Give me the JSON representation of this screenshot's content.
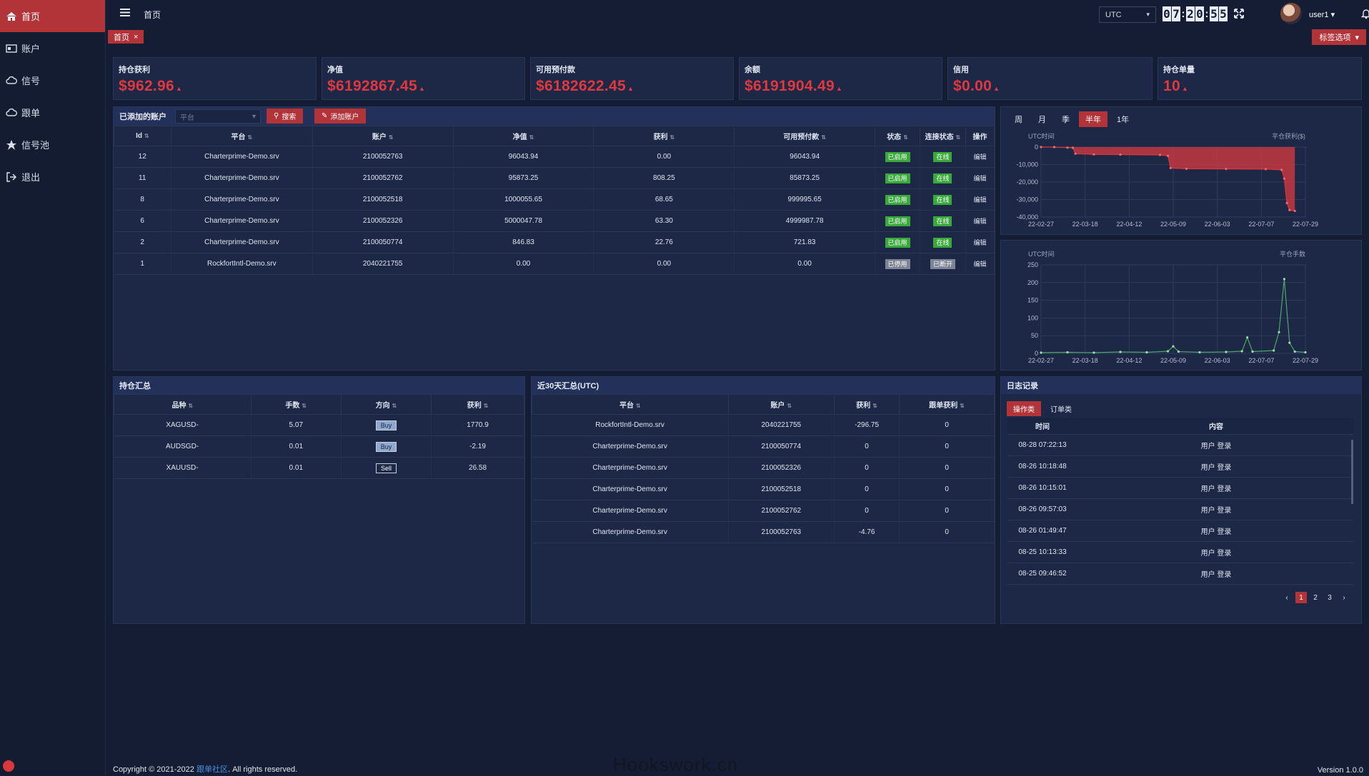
{
  "sidebar": {
    "items": [
      {
        "label": "首页",
        "icon": "home-icon"
      },
      {
        "label": "账户",
        "icon": "id-card-icon"
      },
      {
        "label": "信号",
        "icon": "cloud-icon"
      },
      {
        "label": "跟单",
        "icon": "cloud-icon"
      },
      {
        "label": "信号池",
        "icon": "star-icon"
      },
      {
        "label": "退出",
        "icon": "logout-icon"
      }
    ]
  },
  "header": {
    "breadcrumb": "首页",
    "timezone": "UTC",
    "clock": [
      "0",
      "7",
      ":",
      "2",
      "0",
      ":",
      "5",
      "5"
    ],
    "username": "user1",
    "tab": "首页",
    "tab_close": "×",
    "tab_options": "标签选项"
  },
  "stats": [
    {
      "label": "持仓获利",
      "value": "$962.96"
    },
    {
      "label": "净值",
      "value": "$6192867.45"
    },
    {
      "label": "可用预付款",
      "value": "$6182622.45"
    },
    {
      "label": "余额",
      "value": "$6191904.49"
    },
    {
      "label": "信用",
      "value": "$0.00"
    },
    {
      "label": "持仓单量",
      "value": "10"
    }
  ],
  "accounts": {
    "title": "已添加的账户",
    "platform_placeholder": "平台",
    "search_btn": "搜索",
    "add_btn": "添加账户",
    "columns": [
      "Id",
      "平台",
      "账户",
      "净值",
      "获利",
      "可用预付款",
      "状态",
      "连接状态",
      "操作"
    ],
    "rows": [
      {
        "id": "12",
        "platform": "Charterprime-Demo.srv",
        "account": "2100052763",
        "equity": "96043.94",
        "profit": "0.00",
        "free": "96043.94",
        "status": "已启用",
        "conn": "在线",
        "op": "编辑",
        "on": true
      },
      {
        "id": "11",
        "platform": "Charterprime-Demo.srv",
        "account": "2100052762",
        "equity": "95873.25",
        "profit": "808.25",
        "free": "85873.25",
        "status": "已启用",
        "conn": "在线",
        "op": "编辑",
        "on": true
      },
      {
        "id": "8",
        "platform": "Charterprime-Demo.srv",
        "account": "2100052518",
        "equity": "1000055.65",
        "profit": "68.65",
        "free": "999995.65",
        "status": "已启用",
        "conn": "在线",
        "op": "编辑",
        "on": true
      },
      {
        "id": "6",
        "platform": "Charterprime-Demo.srv",
        "account": "2100052326",
        "equity": "5000047.78",
        "profit": "63.30",
        "free": "4999987.78",
        "status": "已启用",
        "conn": "在线",
        "op": "编辑",
        "on": true
      },
      {
        "id": "2",
        "platform": "Charterprime-Demo.srv",
        "account": "2100050774",
        "equity": "846.83",
        "profit": "22.76",
        "free": "721.83",
        "status": "已启用",
        "conn": "在线",
        "op": "编辑",
        "on": true
      },
      {
        "id": "1",
        "platform": "RockfortIntl-Demo.srv",
        "account": "2040221755",
        "equity": "0.00",
        "profit": "0.00",
        "free": "0.00",
        "status": "已停用",
        "conn": "已断开",
        "op": "编辑",
        "on": false
      }
    ]
  },
  "chart_tabs": [
    "周",
    "月",
    "季",
    "半年",
    "1年"
  ],
  "chart_data": [
    {
      "type": "area",
      "xlabel": "UTC时间",
      "ylabel": "平仓获利($)",
      "x": [
        "22-02-27",
        "22-03-18",
        "22-04-12",
        "22-05-09",
        "22-06-03",
        "22-07-07",
        "22-07-29"
      ],
      "ylim": [
        -40000,
        0
      ],
      "yticks": [
        "0",
        "-10,000",
        "-20,000",
        "-30,000",
        "-40,000"
      ],
      "points": [
        [
          0,
          0
        ],
        [
          0.05,
          0
        ],
        [
          0.1,
          -300
        ],
        [
          0.12,
          -400
        ],
        [
          0.13,
          -3800
        ],
        [
          0.2,
          -4200
        ],
        [
          0.3,
          -4300
        ],
        [
          0.45,
          -4500
        ],
        [
          0.48,
          -5000
        ],
        [
          0.49,
          -12000
        ],
        [
          0.55,
          -12400
        ],
        [
          0.7,
          -12500
        ],
        [
          0.85,
          -12600
        ],
        [
          0.91,
          -13000
        ],
        [
          0.92,
          -18000
        ],
        [
          0.93,
          -32000
        ],
        [
          0.94,
          -36000
        ],
        [
          0.96,
          -36500
        ]
      ],
      "color": "#d9383f"
    },
    {
      "type": "line",
      "xlabel": "UTC时间",
      "ylabel": "平仓手数",
      "x": [
        "22-02-27",
        "22-03-18",
        "22-04-12",
        "22-05-09",
        "22-06-03",
        "22-07-07",
        "22-07-29"
      ],
      "ylim": [
        0,
        250
      ],
      "yticks": [
        "250",
        "200",
        "150",
        "100",
        "50",
        "0"
      ],
      "points": [
        [
          0,
          2
        ],
        [
          0.1,
          3
        ],
        [
          0.2,
          2
        ],
        [
          0.3,
          4
        ],
        [
          0.4,
          3
        ],
        [
          0.48,
          6
        ],
        [
          0.5,
          20
        ],
        [
          0.52,
          5
        ],
        [
          0.6,
          3
        ],
        [
          0.7,
          4
        ],
        [
          0.76,
          6
        ],
        [
          0.78,
          45
        ],
        [
          0.8,
          5
        ],
        [
          0.88,
          8
        ],
        [
          0.9,
          60
        ],
        [
          0.92,
          210
        ],
        [
          0.94,
          30
        ],
        [
          0.96,
          5
        ],
        [
          1,
          3
        ]
      ],
      "color": "#4aa86a"
    }
  ],
  "positions": {
    "title": "持仓汇总",
    "columns": [
      "品种",
      "手数",
      "方向",
      "获利"
    ],
    "rows": [
      {
        "symbol": "XAGUSD-",
        "lots": "5.07",
        "dir": "Buy",
        "profit": "1770.9"
      },
      {
        "symbol": "AUDSGD-",
        "lots": "0.01",
        "dir": "Buy",
        "profit": "-2.19"
      },
      {
        "symbol": "XAUUSD-",
        "lots": "0.01",
        "dir": "Sell",
        "profit": "26.58"
      }
    ]
  },
  "summary30": {
    "title": "近30天汇总(UTC)",
    "columns": [
      "平台",
      "账户",
      "获利",
      "跟单获利"
    ],
    "rows": [
      {
        "platform": "RockfortIntl-Demo.srv",
        "account": "2040221755",
        "profit": "-296.75",
        "copy": "0"
      },
      {
        "platform": "Charterprime-Demo.srv",
        "account": "2100050774",
        "profit": "0",
        "copy": "0"
      },
      {
        "platform": "Charterprime-Demo.srv",
        "account": "2100052326",
        "profit": "0",
        "copy": "0"
      },
      {
        "platform": "Charterprime-Demo.srv",
        "account": "2100052518",
        "profit": "0",
        "copy": "0"
      },
      {
        "platform": "Charterprime-Demo.srv",
        "account": "2100052762",
        "profit": "0",
        "copy": "0"
      },
      {
        "platform": "Charterprime-Demo.srv",
        "account": "2100052763",
        "profit": "-4.76",
        "copy": "0"
      }
    ]
  },
  "logs": {
    "title": "日志记录",
    "tabs": [
      "操作类",
      "订单类"
    ],
    "columns": [
      "时间",
      "内容"
    ],
    "rows": [
      {
        "time": "08-28 07:22:13",
        "content": "用户 登录"
      },
      {
        "time": "08-26 10:18:48",
        "content": "用户 登录"
      },
      {
        "time": "08-26 10:15:01",
        "content": "用户 登录"
      },
      {
        "time": "08-26 09:57:03",
        "content": "用户 登录"
      },
      {
        "time": "08-26 01:49:47",
        "content": "用户 登录"
      },
      {
        "time": "08-25 10:13:33",
        "content": "用户 登录"
      },
      {
        "time": "08-25 09:46:52",
        "content": "用户 登录"
      }
    ],
    "pages": [
      "1",
      "2",
      "3"
    ],
    "prev": "‹",
    "next": "›"
  },
  "footer": {
    "copyright": "Copyright © 2021-2022 ",
    "link": "跟单社区",
    "rights": ". All rights reserved.",
    "version": "Version 1.0.0"
  },
  "watermark": "Hookswork.cn"
}
